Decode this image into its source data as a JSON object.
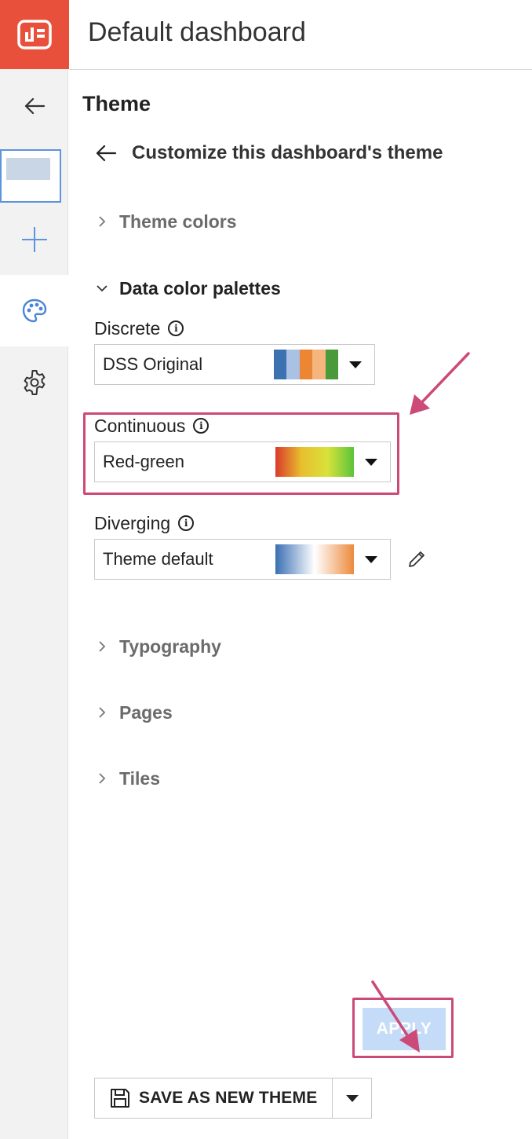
{
  "header": {
    "title": "Default dashboard"
  },
  "panel": {
    "section_title": "Theme",
    "sub_header": "Customize this dashboard's theme",
    "sections": {
      "theme_colors": "Theme colors",
      "data_color_palettes": "Data color palettes",
      "typography": "Typography",
      "pages": "Pages",
      "tiles": "Tiles"
    },
    "discrete": {
      "label": "Discrete",
      "value": "DSS Original",
      "swatch_colors": [
        "#3d72b1",
        "#a8c1e4",
        "#ec8534",
        "#f4b57e",
        "#4a9a3c"
      ]
    },
    "continuous": {
      "label": "Continuous",
      "value": "Red-green",
      "gradient": [
        "#d93a2b",
        "#e9bf2f",
        "#d8e23b",
        "#5cc43b"
      ]
    },
    "diverging": {
      "label": "Diverging",
      "value": "Theme default",
      "gradient": [
        "#3a6fb3",
        "#ffffff",
        "#ec8a3d"
      ]
    }
  },
  "footer": {
    "save_label": "SAVE AS NEW THEME",
    "apply_label": "APPLY"
  },
  "colors": {
    "brand": "#e8503c",
    "highlight": "#cc4a78",
    "apply_disabled": "#c4dcf8",
    "rail_accent": "#5c94dd"
  },
  "icons": {
    "logo": "dashboard-icon",
    "rail": [
      "arrow-left-icon",
      "page-thumbnail",
      "plus-icon",
      "palette-icon",
      "gear-icon"
    ],
    "edit": "pencil-icon",
    "save": "floppy-disk-icon"
  }
}
